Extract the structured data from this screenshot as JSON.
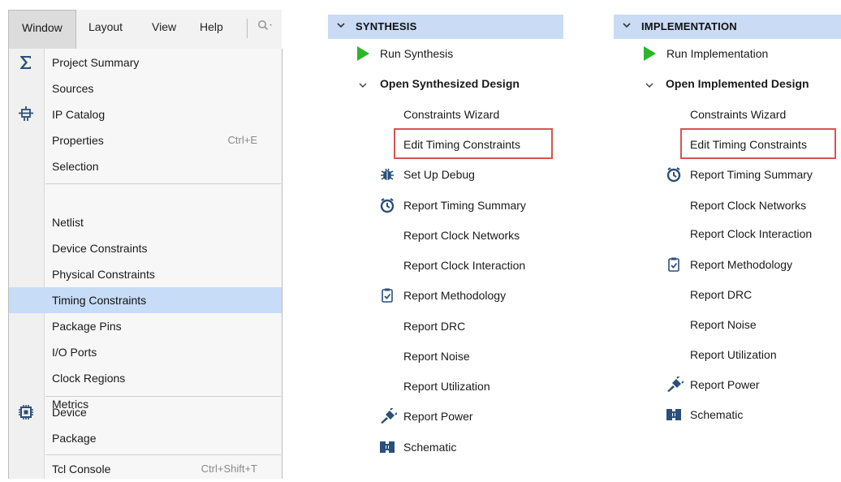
{
  "menubar": {
    "items": [
      "Window",
      "Layout",
      "View",
      "Help"
    ],
    "search_icon": "search-icon"
  },
  "window_menu": {
    "items": [
      {
        "label": "Project Summary",
        "icon": "sigma-icon"
      },
      {
        "label": "Sources"
      },
      {
        "label": "IP Catalog",
        "icon": "ip-core-icon"
      },
      {
        "label": "Properties",
        "shortcut": "Ctrl+E"
      },
      {
        "label": "Selection"
      },
      {
        "label": "Netlist"
      },
      {
        "label": "Device Constraints"
      },
      {
        "label": "Physical Constraints"
      },
      {
        "label": "Timing Constraints",
        "highlighted": true
      },
      {
        "label": "Package Pins"
      },
      {
        "label": "I/O Ports"
      },
      {
        "label": "Clock Regions"
      },
      {
        "label": "Metrics"
      },
      {
        "label": "Device",
        "icon": "chip-icon"
      },
      {
        "label": "Package"
      },
      {
        "label": "Tcl Console",
        "shortcut": "Ctrl+Shift+T"
      }
    ]
  },
  "synthesis": {
    "title": "SYNTHESIS",
    "run": "Run Synthesis",
    "open": "Open Synthesized Design",
    "constraints_wizard": "Constraints Wizard",
    "edit_timing": "Edit Timing Constraints",
    "setup_debug": "Set Up Debug",
    "timing_summary": "Report Timing Summary",
    "clock_networks": "Report Clock Networks",
    "clock_interaction": "Report Clock Interaction",
    "methodology": "Report Methodology",
    "drc": "Report DRC",
    "noise": "Report Noise",
    "utilization": "Report Utilization",
    "power": "Report Power",
    "schematic": "Schematic"
  },
  "implementation": {
    "title": "IMPLEMENTATION",
    "run": "Run Implementation",
    "open": "Open Implemented Design",
    "constraints_wizard": "Constraints Wizard",
    "edit_timing": "Edit Timing Constraints",
    "timing_summary": "Report Timing Summary",
    "clock_networks": "Report Clock Networks",
    "clock_interaction": "Report Clock Interaction",
    "methodology": "Report Methodology",
    "drc": "Report DRC",
    "noise": "Report Noise",
    "utilization": "Report Utilization",
    "power": "Report Power",
    "schematic": "Schematic"
  },
  "colors": {
    "header_bg": "#c9dbf5",
    "highlight_bg": "#c7dcf6",
    "run_green": "#2bb52b",
    "callout_red": "#d9534f",
    "icon_blue": "#2a5b8c"
  }
}
